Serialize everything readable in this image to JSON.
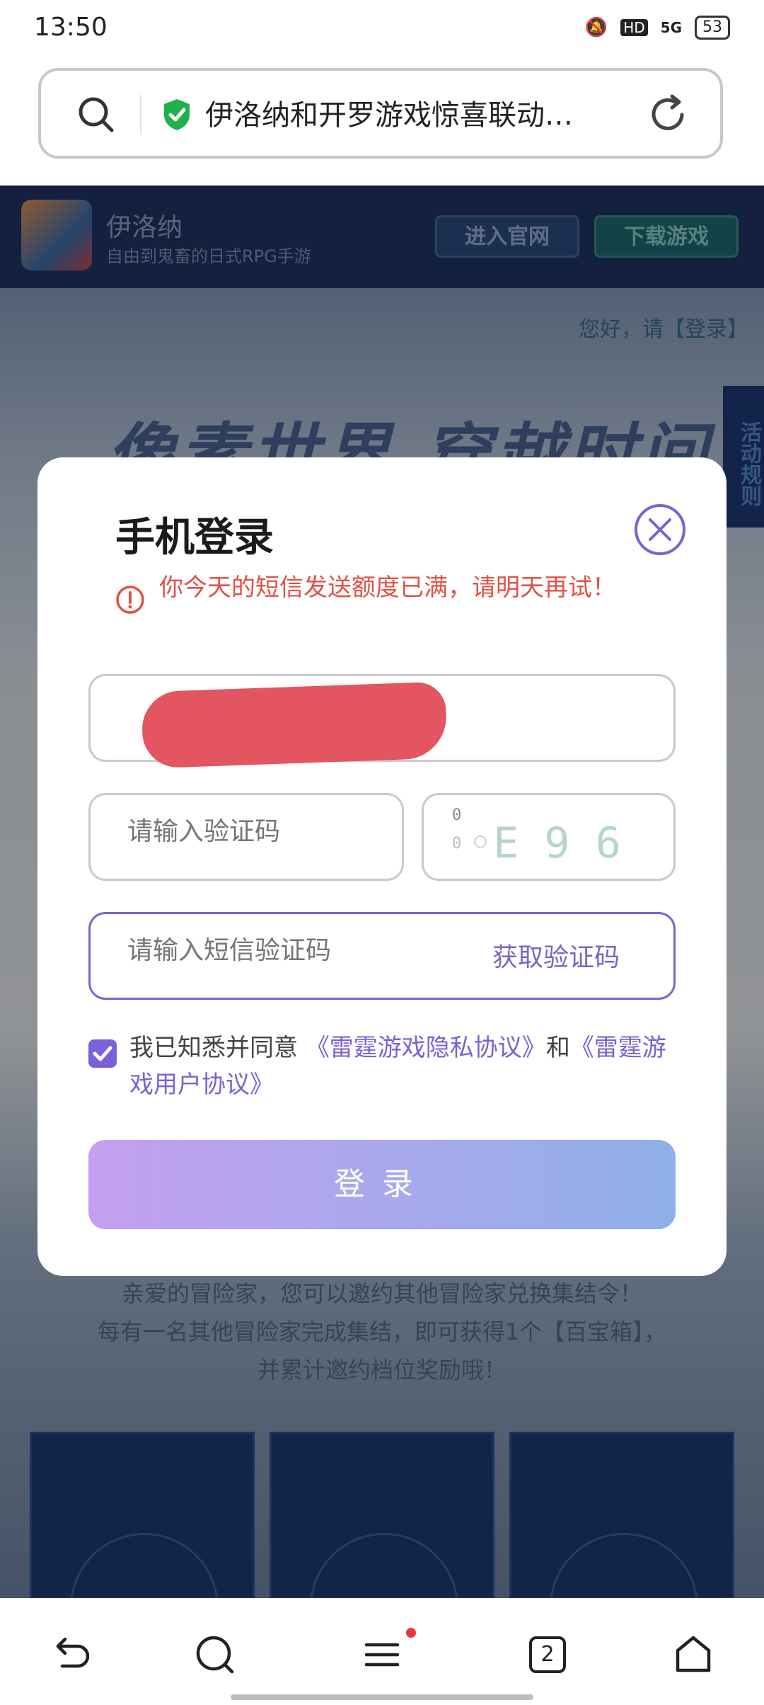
{
  "status_bar": {
    "time": "13:50",
    "network": "5G",
    "hd": "HD",
    "battery": "53"
  },
  "urlbar": {
    "title": "伊洛纳和开罗游戏惊喜联动…"
  },
  "site": {
    "name": "伊洛纳",
    "desc": "自由到鬼畜的日式RPG手游",
    "btn_official": "进入官网",
    "btn_download": "下载游戏",
    "greeting": "您好，请【登录】",
    "banner": "像素世界 穿越时间",
    "rules_tab": "活动规则",
    "invite_lines": [
      "亲爱的冒险家，您可以邀约其他冒险家兑换集结令！",
      "每有一名其他冒险家完成集结，即可获得1个【百宝箱】，",
      "并累计邀约档位奖励哦！"
    ]
  },
  "modal": {
    "title": "手机登录",
    "error": "你今天的短信发送额度已满，请明天再试！",
    "code_placeholder": "请输入验证码",
    "captcha_text": "◦E 9 6",
    "sms_placeholder": "请输入短信验证码",
    "sms_get": "获取验证码",
    "agree_prefix": "我已知悉并同意",
    "agree_privacy": "《雷霆游戏隐私协议》",
    "agree_and": "和",
    "agree_user": "《雷霆游戏用户协议》",
    "login": "登录"
  },
  "nav": {
    "tabs_count": "2"
  },
  "colors": {
    "accent": "#7a62d6",
    "error": "#e05246",
    "header": "#1f3566"
  }
}
